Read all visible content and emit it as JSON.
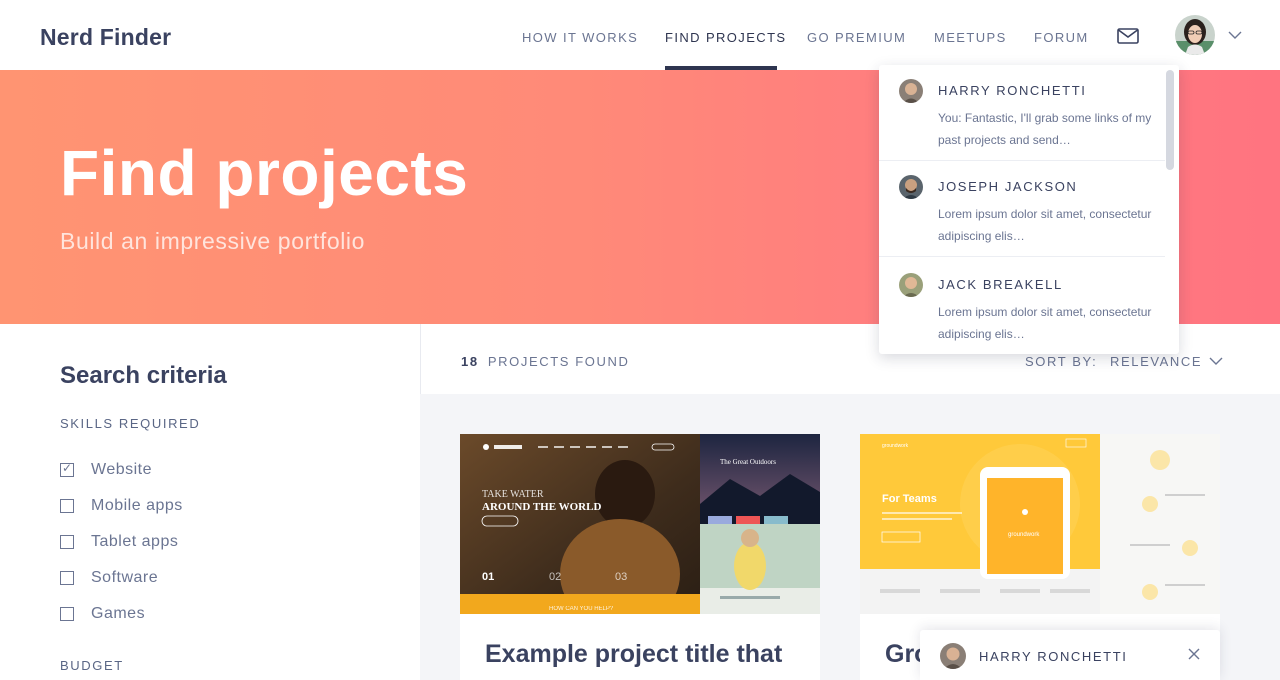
{
  "header": {
    "logo": "Nerd Finder",
    "nav": [
      {
        "label": "HOW IT WORKS"
      },
      {
        "label": "FIND PROJECTS",
        "active": true
      },
      {
        "label": "GO PREMIUM"
      },
      {
        "label": "MEETUPS"
      },
      {
        "label": "FORUM"
      }
    ],
    "icons": {
      "mail": "mail-icon",
      "profile_menu": "chevron-down-icon"
    }
  },
  "hero": {
    "title": "Find projects",
    "subtitle": "Build an impressive portfolio"
  },
  "sidebar": {
    "title": "Search criteria",
    "skills_label": "SKILLS REQUIRED",
    "skills": [
      {
        "label": "Website",
        "checked": true
      },
      {
        "label": "Mobile apps",
        "checked": false
      },
      {
        "label": "Tablet apps",
        "checked": false
      },
      {
        "label": "Software",
        "checked": false
      },
      {
        "label": "Games",
        "checked": false
      }
    ],
    "budget_label": "BUDGET"
  },
  "results": {
    "count": "18",
    "count_label": "PROJECTS FOUND",
    "sort_label": "SORT BY:",
    "sort_value": "RELEVANCE"
  },
  "cards": [
    {
      "title": "Example project title that",
      "thumb": {
        "brand": "inCharity",
        "headline_1": "TAKE WATER",
        "headline_2": "AROUND THE WORLD",
        "cta": "join with us",
        "steps": [
          "01",
          "02",
          "03"
        ],
        "footer": "HOW CAN YOU HELP?",
        "side_title": "The Great Outdoors",
        "side_sub": "Explore the World"
      }
    },
    {
      "title": "Gro",
      "thumb": {
        "brand": "groundwork",
        "headline": "For Teams",
        "device_brand": "groundwork"
      }
    }
  ],
  "messages": {
    "items": [
      {
        "name": "HARRY RONCHETTI",
        "text": "You: Fantastic, I'll grab some links of my past projects and send…"
      },
      {
        "name": "JOSEPH JACKSON",
        "text": "Lorem ipsum dolor sit amet, consectetur adipiscing elis…"
      },
      {
        "name": "JACK BREAKELL",
        "text": "Lorem ipsum dolor sit amet, consectetur adipiscing elis…"
      }
    ]
  },
  "chat": {
    "name": "HARRY RONCHETTI",
    "close_icon": "close-icon"
  },
  "colors": {
    "hero_gradient_start": "#ff9472",
    "hero_gradient_end": "#ff7480",
    "navy_text": "#3a4260",
    "muted_text": "#6b7592"
  }
}
